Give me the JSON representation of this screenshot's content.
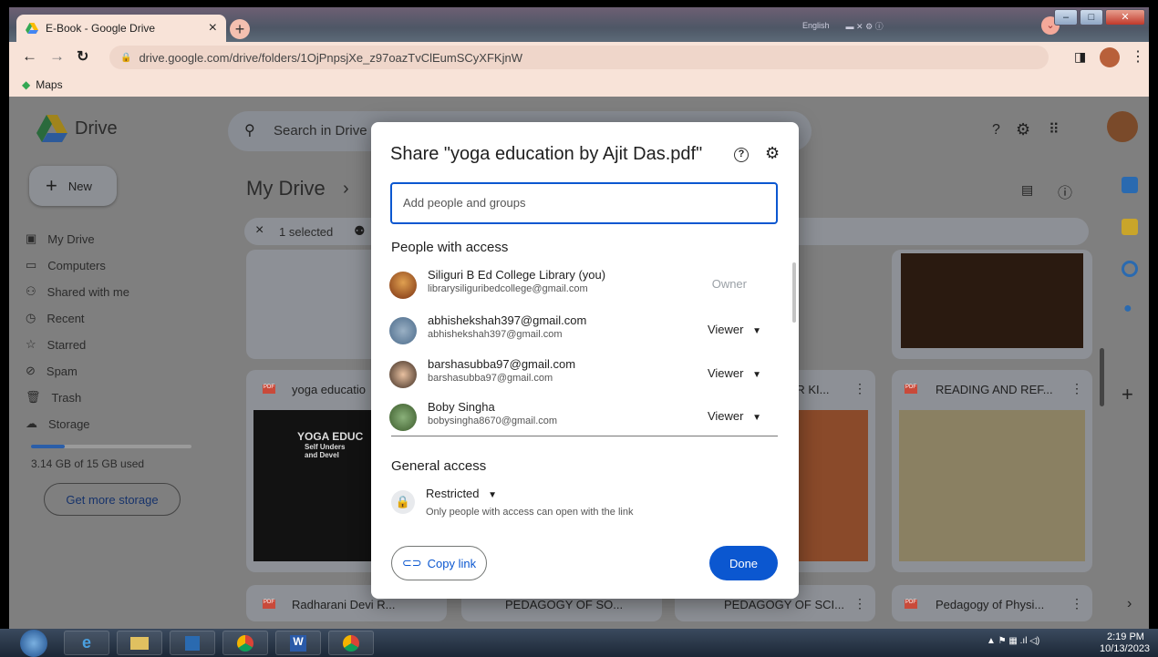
{
  "browser": {
    "tab_title": "E-Book - Google Drive",
    "tab_close": "×",
    "new_tab": "+",
    "url": "drive.google.com/drive/folders/1OjPnpsjXe_z97oazTvClEumSCyXFKjnW",
    "bookmark_maps": "Maps",
    "lang_label": "English"
  },
  "drive": {
    "brand": "Drive",
    "search_placeholder": "Search in Drive",
    "new_label": "New",
    "breadcrumb": "My Drive",
    "breadcrumb_sep": "›",
    "selection": {
      "close": "×",
      "count": "1 selected"
    },
    "nav": [
      "My Drive",
      "Computers",
      "Shared with me",
      "Recent",
      "Starred",
      "Spam",
      "Trash",
      "Storage"
    ],
    "storage_text": "3.14 GB of 15 GB used",
    "storage_fraction": 0.21,
    "storage_button": "Get more storage",
    "files": {
      "row2": [
        "yoga educatio",
        "DR KI...",
        "READING AND REF..."
      ],
      "row3": [
        "Radharani Devi R...",
        "PEDAGOGY OF SO...",
        "PEDAGOGY OF SCI...",
        "Pedagogy of Physi..."
      ]
    },
    "thumb_yoga": [
      "YOGA EDUC",
      "Self Unders",
      "and Devel"
    ]
  },
  "dialog": {
    "title": "Share \"yoga education by Ajit Das.pdf\"",
    "input_placeholder": "Add people and groups",
    "people_heading": "People with access",
    "people": [
      {
        "name": "Siliguri B Ed College Library (you)",
        "email": "librarysiliguribedcollege@gmail.com",
        "role": "Owner"
      },
      {
        "name": "abhishekshah397@gmail.com",
        "email": "abhishekshah397@gmail.com",
        "role": "Viewer"
      },
      {
        "name": "barshasubba97@gmail.com",
        "email": "barshasubba97@gmail.com",
        "role": "Viewer"
      },
      {
        "name": "Boby Singha",
        "email": "bobysingha8670@gmail.com",
        "role": "Viewer"
      }
    ],
    "general_heading": "General access",
    "access_level": "Restricted",
    "access_desc": "Only people with access can open with the link",
    "copy_link": "Copy link",
    "done": "Done"
  },
  "taskbar": {
    "time": "2:19 PM",
    "date": "10/13/2023"
  },
  "colors": {
    "accent": "#0b57d0",
    "drive_bg": "#7f7f7f",
    "owner_gray": "#9aa0a6"
  }
}
